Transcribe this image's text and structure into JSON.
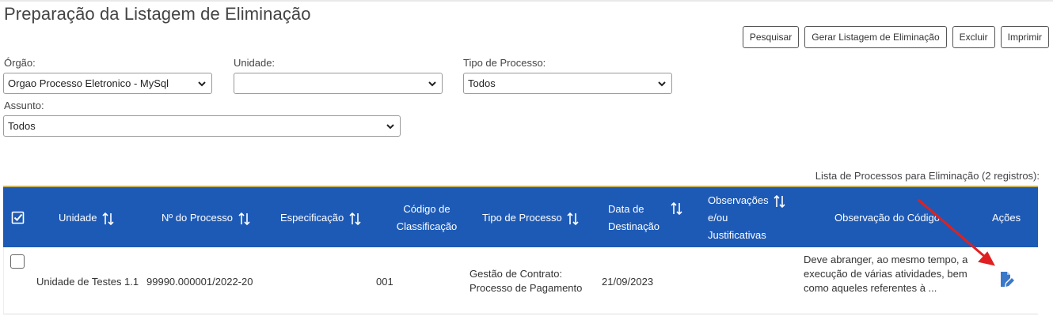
{
  "page": {
    "title": "Preparação da Listagem de Eliminação"
  },
  "toolbar": {
    "search_label": "Pesquisar",
    "generate_label": "Gerar Listagem de Eliminação",
    "delete_label": "Excluir",
    "print_label": "Imprimir"
  },
  "filters": {
    "orgao": {
      "label": "Órgão:",
      "value": "Orgao Processo Eletronico - MySql"
    },
    "unidade": {
      "label": "Unidade:",
      "value": ""
    },
    "tipo": {
      "label": "Tipo de Processo:",
      "value": "Todos"
    },
    "assunto": {
      "label": "Assunto:",
      "value": "Todos"
    }
  },
  "table": {
    "caption": "Lista de Processos para Eliminação (2 registros):",
    "headers": {
      "unidade": "Unidade",
      "numero": "Nº do Processo",
      "especificacao": "Especificação",
      "codigo_1": "Código de",
      "codigo_2": "Classificação",
      "tipo": "Tipo de Processo",
      "data_1": "Data de",
      "data_2": "Destinação",
      "obs_1": "Observações",
      "obs_2": "e/ou",
      "obs_3": "Justificativas",
      "obs_codigo": "Observação do Código",
      "acoes": "Ações"
    },
    "rows": [
      {
        "unidade": "Unidade de Testes 1.1",
        "numero": "99990.000001/2022-20",
        "especificacao": "",
        "codigo": "001",
        "tipo_1": "Gestão de Contrato:",
        "tipo_2": "Processo de Pagamento",
        "data": "21/09/2023",
        "observacoes": "",
        "obs_codigo_1": "Deve abranger, ao mesmo tempo, a",
        "obs_codigo_2": "execução de várias atividades, bem",
        "obs_codigo_3": "como aqueles referentes à ..."
      }
    ]
  },
  "colors": {
    "header_bg": "#1d5ab6",
    "action_icon": "#3a78c9",
    "annotation_arrow": "#e02020"
  }
}
